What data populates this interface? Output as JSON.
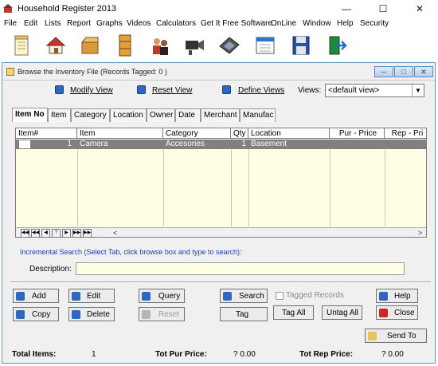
{
  "window": {
    "title": "Household Register 2013",
    "min_glyph": "—",
    "max_glyph": "☐",
    "close_glyph": "✕"
  },
  "menu": [
    "File",
    "Edit",
    "Lists",
    "Report",
    "Graphs",
    "Videos",
    "Calculators",
    "Get It Free Software",
    "OnLine",
    "Window",
    "Help",
    "Security"
  ],
  "toolbar": [
    {
      "name": "notepad-icon"
    },
    {
      "name": "house-icon"
    },
    {
      "name": "box-icon"
    },
    {
      "name": "cabinet-icon"
    },
    {
      "name": "people-icon"
    },
    {
      "name": "camcorder-icon"
    },
    {
      "name": "calculator-icon"
    },
    {
      "name": "calendar-icon"
    },
    {
      "name": "save-icon"
    },
    {
      "name": "exit-icon"
    }
  ],
  "child": {
    "title": "Browse the Inventory File  (Records Tagged: 0 )",
    "modify_view": "Modify View",
    "reset_view": "Reset View",
    "define_views": "Define Views",
    "views_label": "Views:",
    "views_value": "<default view>"
  },
  "tabs": [
    "Item No",
    "Item",
    "Category",
    "Location",
    "Owner",
    "Date",
    "Merchant",
    "Manufac"
  ],
  "grid": {
    "columns": [
      "Item#",
      "Item",
      "Category",
      "Qty",
      "Location",
      "Pur - Price",
      "Rep - Pri"
    ],
    "rows": [
      {
        "item_no": "1",
        "item": "Camera",
        "category": "Accesories",
        "qty": "1",
        "location": "Basement",
        "pur_price": "",
        "rep_price": ""
      }
    ]
  },
  "incremental_search": "Incremental Search (Select Tab, click browse box and type to search):",
  "description_label": "Description:",
  "description_value": "",
  "buttons": {
    "add": "Add",
    "copy": "Copy",
    "edit": "Edit",
    "delete": "Delete",
    "query": "Query",
    "reset": "Reset",
    "search": "Search",
    "tag": "Tag",
    "tagged_records": "Tagged Records",
    "tag_all": "Tag All",
    "untag_all": "Untag All",
    "help": "Help",
    "close": "Close",
    "send_to": "Send To"
  },
  "totals": {
    "items_label": "Total Items:",
    "items_value": "1",
    "pur_label": "Tot Pur Price:",
    "pur_value": "? 0.00",
    "rep_label": "Tot Rep Price:",
    "rep_value": "? 0.00"
  },
  "colors": {
    "grid_bg": "#ffffe6",
    "selected_row": "#808080",
    "link_blue": "#1f3ac0"
  }
}
